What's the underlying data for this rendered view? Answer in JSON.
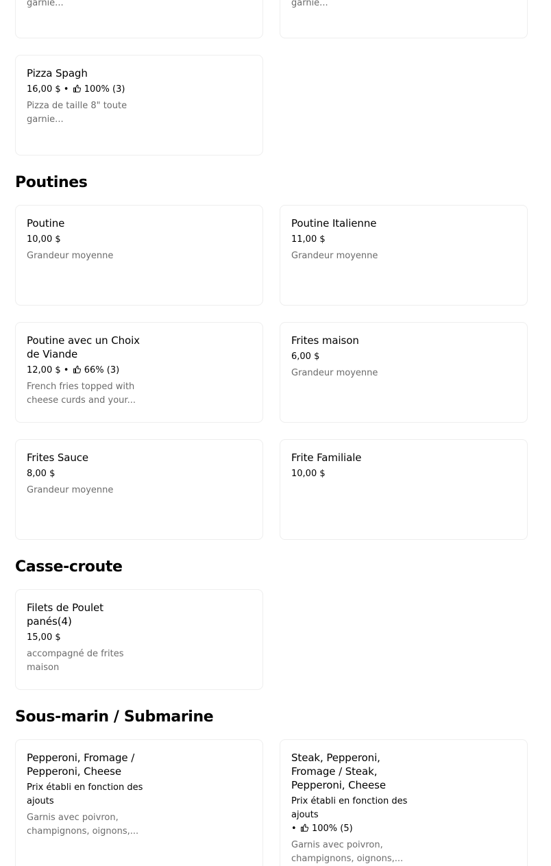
{
  "top_cards": {
    "left_desc": "garnie...",
    "right_desc": "garnie..."
  },
  "pizza_spagh": {
    "name": "Pizza Spagh",
    "price": "16,00 $",
    "rating": "100% (3)",
    "desc_line1": "Pizza de taille 8\" toute",
    "desc_line2": "garnie..."
  },
  "sections": {
    "poutines": "Poutines",
    "casse_croute": "Casse-croute",
    "sous_marin": "Sous-marin / Submarine"
  },
  "poutines": [
    {
      "name": "Poutine",
      "price": "10,00 $",
      "desc": "Grandeur moyenne"
    },
    {
      "name": "Poutine Italienne",
      "price": "11,00 $",
      "desc": "Grandeur moyenne"
    },
    {
      "name_line1": "Poutine avec un Choix",
      "name_line2": "de Viande",
      "price": "12,00 $",
      "rating": "66% (3)",
      "desc_line1": "French fries topped with",
      "desc_line2": "cheese curds and your..."
    },
    {
      "name": "Frites maison",
      "price": "6,00 $",
      "desc": "Grandeur moyenne"
    },
    {
      "name": "Frites Sauce",
      "price": "8,00 $",
      "desc": "Grandeur moyenne"
    },
    {
      "name": "Frite Familiale",
      "price": "10,00 $"
    }
  ],
  "casse_croute": [
    {
      "name_line1": "Filets de Poulet",
      "name_line2": "panés(4)",
      "price": "15,00 $",
      "desc_line1": "accompagné de frites",
      "desc_line2": "maison"
    }
  ],
  "sous_marin": [
    {
      "name_line1": "Pepperoni, Fromage /",
      "name_line2": "Pepperoni, Cheese",
      "price_line1": "Prix établi en fonction des",
      "price_line2": "ajouts",
      "desc_line1": "Garnis avec poivron,",
      "desc_line2": "champignons, oignons,..."
    },
    {
      "name_line1": "Steak, Pepperoni,",
      "name_line2": "Fromage / Steak,",
      "name_line3": "Pepperoni, Cheese",
      "price_line1": "Prix établi en fonction des",
      "price_line2": "ajouts",
      "rating": "100% (5)",
      "desc_line1": "Garnis avec poivron,",
      "desc_line2": "champignons, oignons,..."
    }
  ],
  "separators": {
    "bullet": "•"
  },
  "icons": {
    "rating": "thumbs-up-icon"
  }
}
